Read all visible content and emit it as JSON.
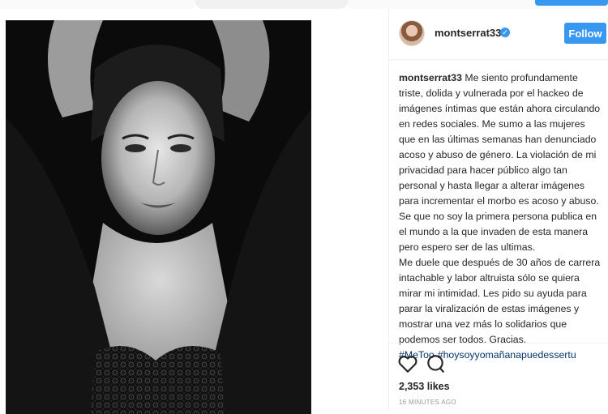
{
  "post": {
    "username": "montserrat33",
    "follow_label": "Follow",
    "caption_text": "Me siento profundamente triste, dolida y vulnerada por el hackeo de imágenes íntimas que están ahora circulando en redes sociales. Me sumo a las mujeres que en las últimas semanas han denunciado acoso y abuso de género. La violación de mi privacidad para hacer público algo tan personal y hasta llegar a alterar imágenes para incrementar el morbo es acoso y abuso. Se que no soy la primera persona publica en el mundo a la que invaden de esta manera pero espero ser de las ultimas.",
    "caption_text_2": "Me duele que después de 30 años de carrera intachable y labor altruista sólo se quiera mirar mi intimidad. Les pido su ayuda para parar la viralización de estas imágenes y mostrar una vez más lo solidarios que podemos ser todos. Gracias.",
    "hashtags": [
      "#MeToo",
      "#hoysoyyomañanapuedessertu"
    ],
    "likes": "2,353 likes",
    "timestamp": "16 MINUTES AGO"
  },
  "icons": {
    "verified": "verified-badge-icon",
    "like": "heart-icon",
    "comment": "comment-icon"
  },
  "colors": {
    "accent": "#3897f0",
    "text": "#262626",
    "hashtag": "#003569",
    "muted": "#999999"
  }
}
